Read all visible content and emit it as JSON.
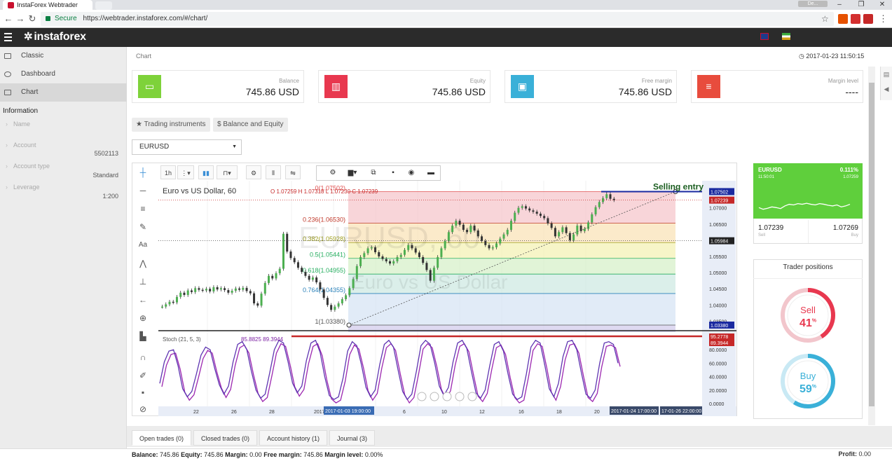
{
  "browser": {
    "tab_title": "InstaForex Webtrader",
    "user_label": "De...",
    "secure_label": "Secure",
    "url": "https://webtrader.instaforex.com/#/chart/"
  },
  "header": {
    "logo": "instaforex"
  },
  "sidebar": {
    "items": [
      {
        "label": "Classic"
      },
      {
        "label": "Dashboard"
      },
      {
        "label": "Chart"
      }
    ],
    "info_title": "Information",
    "info": [
      {
        "label": "Name",
        "value": ""
      },
      {
        "label": "Account",
        "value": "5502113"
      },
      {
        "label": "Account type",
        "value": "Standard"
      },
      {
        "label": "Leverage",
        "value": "1:200"
      }
    ]
  },
  "page": {
    "breadcrumb": "Chart",
    "datetime": "2017-01-23 11:50:15"
  },
  "cards": [
    {
      "label": "Balance",
      "value": "745.86 USD",
      "color": "#7ed23a",
      "icon": "wallet-icon"
    },
    {
      "label": "Equity",
      "value": "745.86 USD",
      "color": "#e8384f",
      "icon": "bar-chart-icon"
    },
    {
      "label": "Free margin",
      "value": "745.86 USD",
      "color": "#3ab0d8",
      "icon": "money-icon"
    },
    {
      "label": "Margin level",
      "value": "----",
      "color": "#e84c3d",
      "icon": "list-icon"
    }
  ],
  "pills": {
    "instruments": "★ Trading instruments",
    "balance": "$ Balance and Equity"
  },
  "symbol_select": "EURUSD",
  "chart_toolbar": {
    "timeframe": "1h"
  },
  "chart_data": {
    "type": "candlestick",
    "title": "Euro vs US Dollar, 60",
    "ohlc_label": "O 1.07259 H 1.07318 L 1.07230 C 1.07239",
    "watermark_symbol": "EURUSD, 60",
    "watermark_name": "Euro vs US Dollar",
    "annotation": "Selling entry",
    "y_ticks": [
      "1.07000",
      "1.06500",
      "1.06000",
      "1.05500",
      "1.05000",
      "1.04500",
      "1.04000",
      "1.03500"
    ],
    "price_badges": [
      {
        "value": "1.07502",
        "color": "#1a2aa0"
      },
      {
        "value": "1.07239",
        "color": "#c62828"
      },
      {
        "value": "1.05984",
        "color": "#222222"
      },
      {
        "value": "1.03380",
        "color": "#1a2aa0"
      }
    ],
    "x_ticks": [
      "22",
      "26",
      "28",
      "2017",
      "6",
      "10",
      "12",
      "16",
      "18",
      "20"
    ],
    "x_highlights": [
      "2017-01-03 19:00:00",
      "2017-01-24 17:00:00",
      "17-01-26 22:00:00"
    ],
    "fib_levels": [
      {
        "ratio": "0(1.07502)",
        "price": 1.07502,
        "color": "#e05050"
      },
      {
        "ratio": "0.236(1.06530)",
        "price": 1.0653,
        "color": "#c0392b"
      },
      {
        "ratio": "0.382(1.05928)",
        "price": 1.05928,
        "color": "#a0a020"
      },
      {
        "ratio": "0.5(1.05441)",
        "price": 1.05441,
        "color": "#27ae60"
      },
      {
        "ratio": "0.618(1.04955)",
        "price": 1.04955,
        "color": "#27ae60"
      },
      {
        "ratio": "0.764(1.04355)",
        "price": 1.04355,
        "color": "#2980b9"
      },
      {
        "ratio": "1(1.03380)",
        "price": 1.0338,
        "color": "#555555"
      }
    ],
    "ylim": [
      1.0325,
      1.0775
    ],
    "close_series": [
      1.0395,
      1.0402,
      1.041,
      1.0408,
      1.0425,
      1.0438,
      1.0431,
      1.0445,
      1.044,
      1.0452,
      1.0447,
      1.0445,
      1.045,
      1.0442,
      1.0455,
      1.0448,
      1.0452,
      1.0446,
      1.0438,
      1.0444,
      1.0451,
      1.0447,
      1.0453,
      1.0443,
      1.0436,
      1.0405,
      1.0398,
      1.0435,
      1.0468,
      1.049,
      1.0482,
      1.0498,
      1.0512,
      1.062,
      1.0565,
      1.0545,
      1.0532,
      1.0515,
      1.0502,
      1.049,
      1.0478,
      1.0485,
      1.047,
      1.0448,
      1.0422,
      1.04,
      1.0385,
      1.0395,
      1.0405,
      1.0418,
      1.043,
      1.0452,
      1.048,
      1.052,
      1.0548,
      1.056,
      1.0575,
      1.0578,
      1.0563,
      1.055,
      1.0542,
      1.0535,
      1.0528,
      1.0535,
      1.0548,
      1.0555,
      1.057,
      1.0585,
      1.0575,
      1.0562,
      1.0548,
      1.053,
      1.0508,
      1.0475,
      1.0515,
      1.0548,
      1.0575,
      1.0598,
      1.0625,
      1.0645,
      1.066,
      1.0648,
      1.0632,
      1.0625,
      1.0645,
      1.063,
      1.0612,
      1.0598,
      1.0585,
      1.0575,
      1.0578,
      1.059,
      1.0605,
      1.0618,
      1.0632,
      1.066,
      1.0685,
      1.07,
      1.0705,
      1.0698,
      1.0692,
      1.0688,
      1.0682,
      1.0675,
      1.0668,
      1.0652,
      1.0638,
      1.0612,
      1.0625,
      1.064,
      1.0622,
      1.06,
      1.0618,
      1.0645,
      1.0628,
      1.0635,
      1.0655,
      1.068,
      1.0702,
      1.0718,
      1.073,
      1.0742,
      1.0728,
      1.0724
    ],
    "stoch_label": "Stoch (21, 5, 3)",
    "stoch_values": "85.8825 89.3944",
    "stoch_badges": [
      "95.2778",
      "89.3944"
    ],
    "stoch_ticks": [
      "80.0000",
      "60.0000",
      "40.0000",
      "20.0000",
      "0.0000"
    ],
    "stoch_series": [
      30,
      62,
      78,
      80,
      56,
      22,
      10,
      18,
      44,
      72,
      84,
      80,
      52,
      28,
      14,
      26,
      62,
      88,
      92,
      80,
      48,
      20,
      8,
      14,
      46,
      80,
      94,
      90,
      62,
      30,
      16,
      26,
      64,
      90,
      94,
      76,
      40,
      12,
      6,
      10,
      38,
      78,
      92,
      86,
      58,
      24,
      10,
      20,
      58,
      88,
      94,
      84,
      50,
      18,
      6,
      14,
      48,
      86,
      94,
      88,
      60,
      26,
      12,
      24,
      62,
      90,
      94,
      82,
      48,
      16,
      8,
      20,
      56,
      88,
      92,
      78,
      44,
      14,
      6,
      10,
      44,
      84,
      94,
      90,
      58,
      22,
      10,
      30,
      70,
      92,
      94,
      80,
      46,
      14,
      8,
      20,
      60,
      90,
      92,
      88,
      60
    ]
  },
  "quote": {
    "symbol": "EURUSD",
    "change": "0.111%",
    "time": "11:50:01",
    "high": "1.07259",
    "bid": "1.07239",
    "ask": "1.07269",
    "sell_label": "Sell",
    "buy_label": "Buy",
    "spark": [
      0.5,
      0.45,
      0.48,
      0.52,
      0.5,
      0.47,
      0.55,
      0.6,
      0.58,
      0.62,
      0.6,
      0.63,
      0.6,
      0.58,
      0.62,
      0.6,
      0.57,
      0.55,
      0.58,
      0.52,
      0.55,
      0.6
    ]
  },
  "trader_positions": {
    "title": "Trader positions",
    "sell_label": "Sell",
    "sell_pct": 41,
    "buy_label": "Buy",
    "buy_pct": 59,
    "pct_suffix": "%",
    "sell_color": "#e8384f",
    "buy_color": "#3ab0d8"
  },
  "bottom_tabs": [
    {
      "label": "Open trades (0)",
      "active": true
    },
    {
      "label": "Closed trades (0)",
      "active": false
    },
    {
      "label": "Account history (1)",
      "active": false
    },
    {
      "label": "Journal (3)",
      "active": false
    }
  ],
  "status": {
    "balance_label": "Balance:",
    "balance": "745.86",
    "equity_label": "Equity:",
    "equity": "745.86",
    "margin_label": "Margin:",
    "margin": "0.00",
    "free_margin_label": "Free margin:",
    "free_margin": "745.86",
    "margin_level_label": "Margin level:",
    "margin_level": "0.00%",
    "profit_label": "Profit:",
    "profit": "0.00"
  }
}
